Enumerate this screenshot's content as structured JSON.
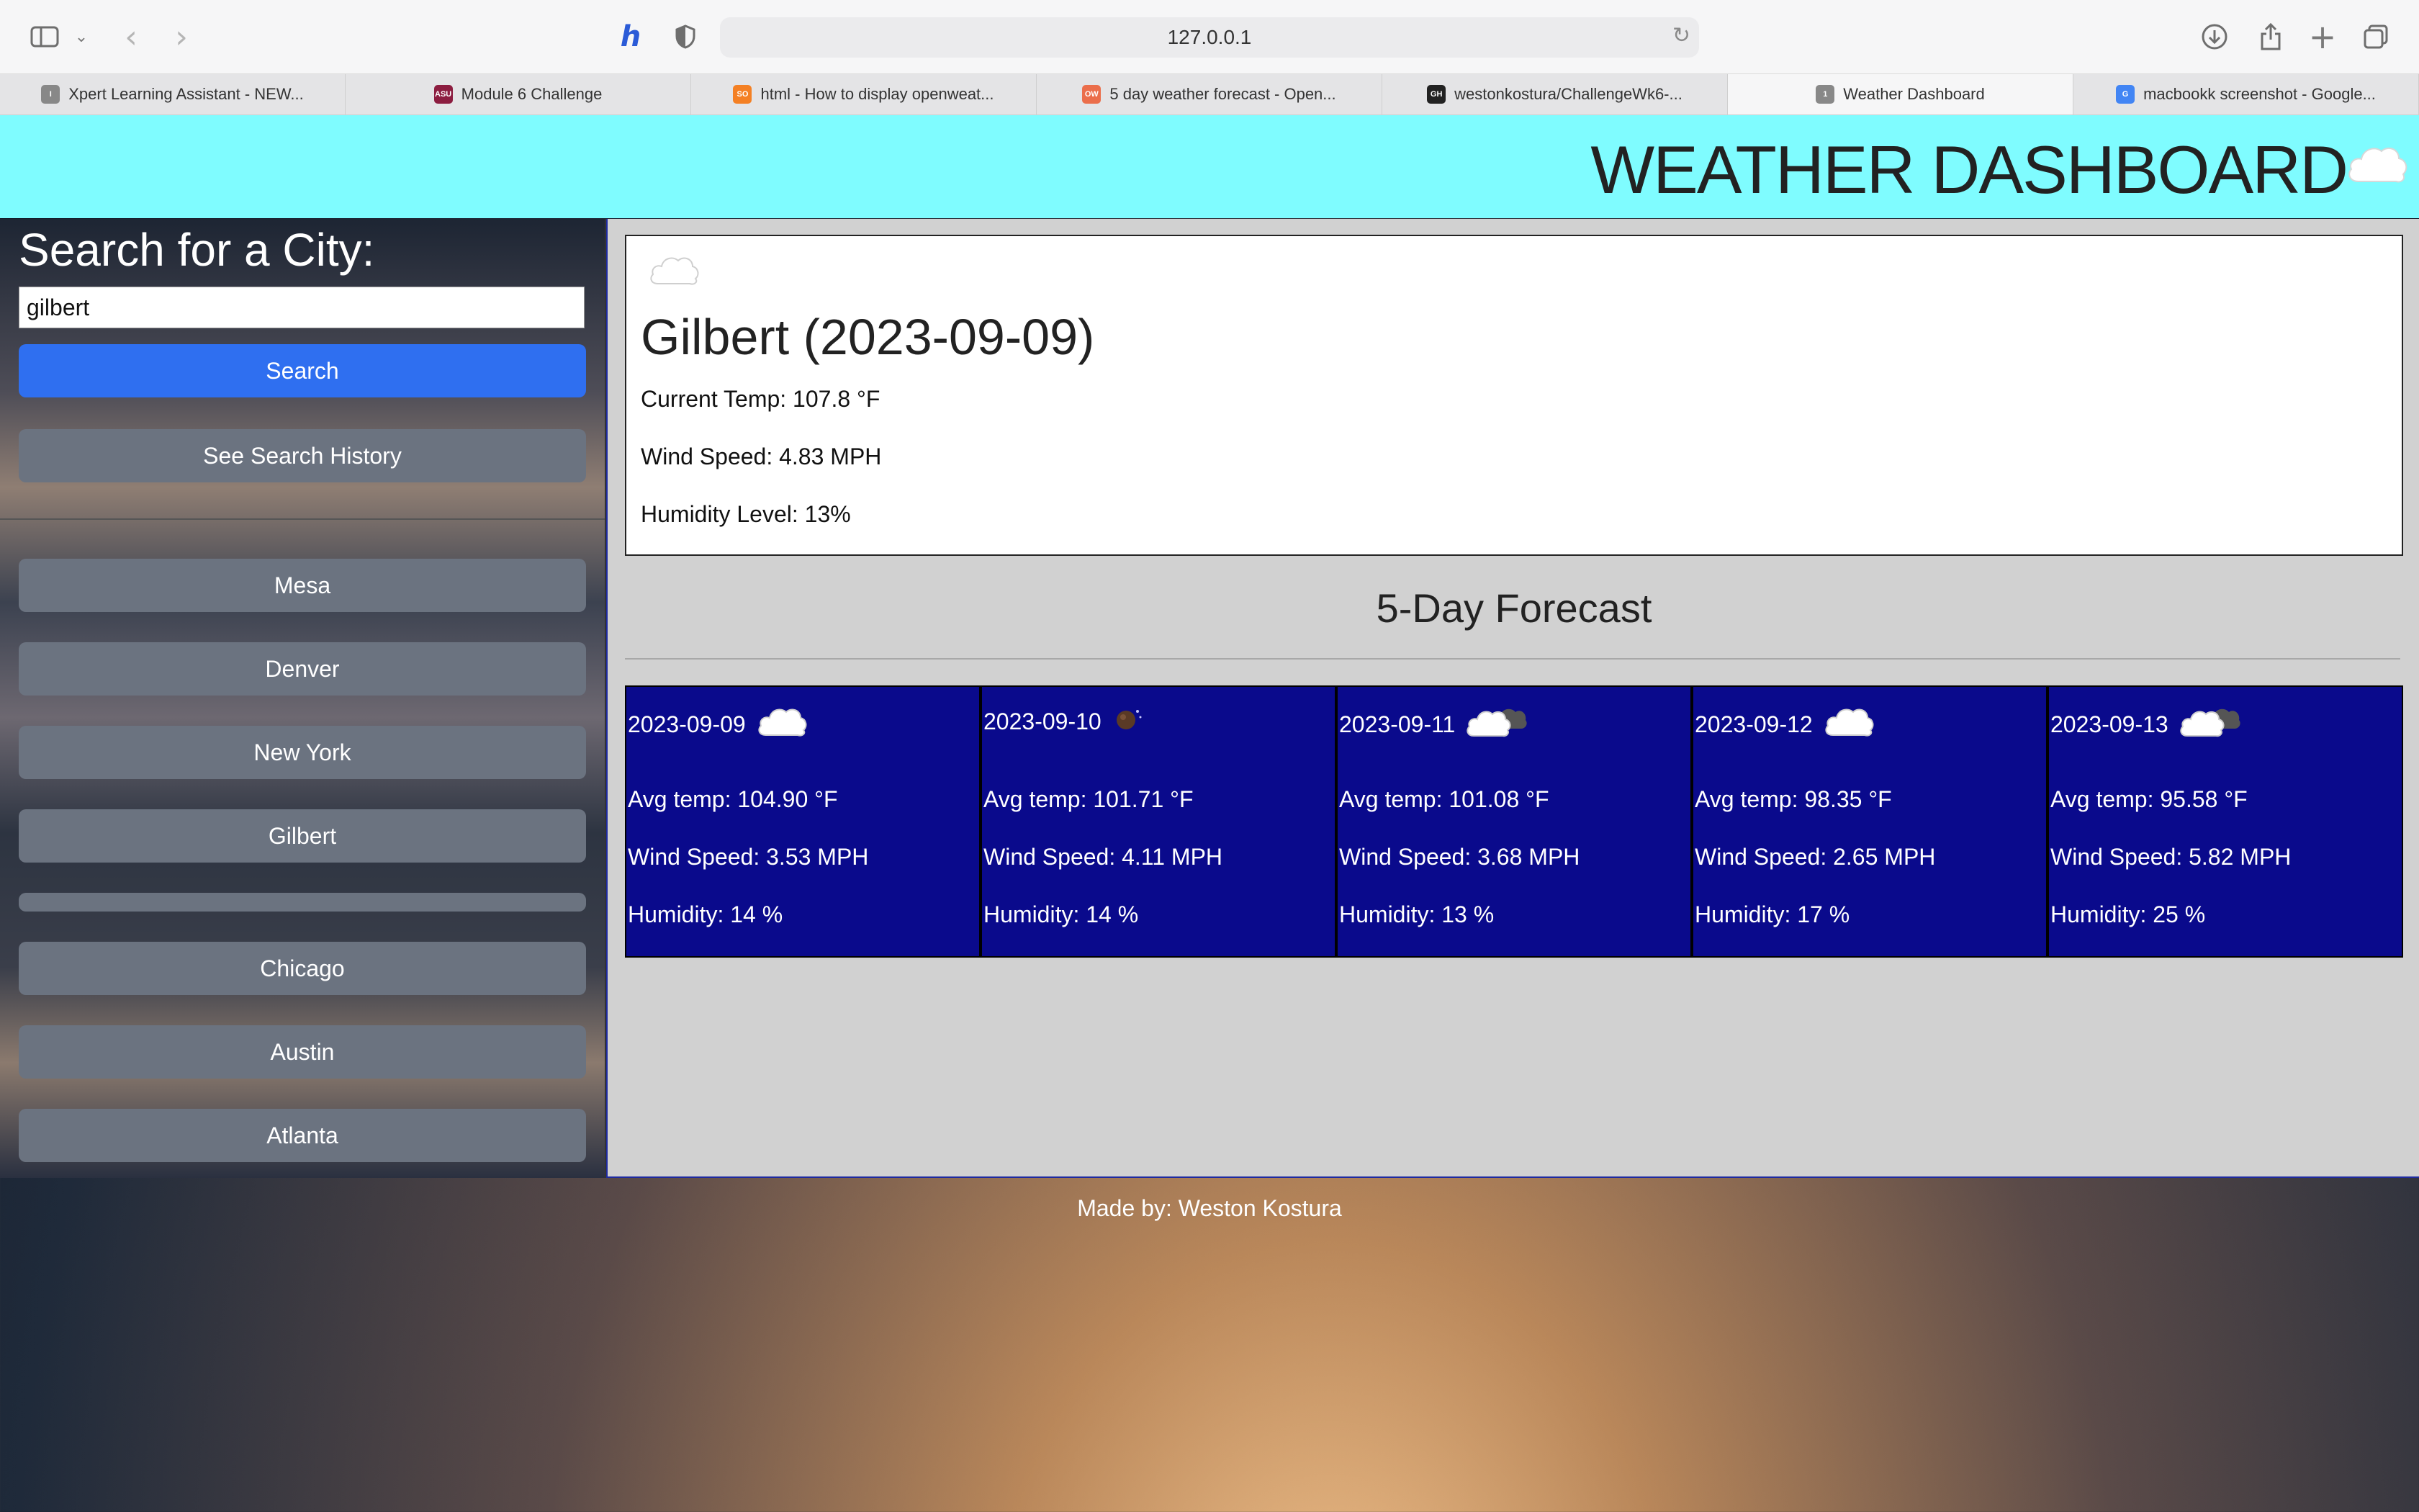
{
  "browser": {
    "url": "127.0.0.1",
    "tabs": [
      {
        "label": "Xpert Learning Assistant - NEW...",
        "favicon": "I",
        "color": "#888888"
      },
      {
        "label": "Module 6 Challenge",
        "favicon": "ASU",
        "color": "#8c1d40"
      },
      {
        "label": "html - How to display openweat...",
        "favicon": "SO",
        "color": "#f48024"
      },
      {
        "label": "5 day weather forecast - Open...",
        "favicon": "OW",
        "color": "#eb6e4b"
      },
      {
        "label": "westonkostura/ChallengeWk6-...",
        "favicon": "GH",
        "color": "#222222"
      },
      {
        "label": "Weather Dashboard",
        "favicon": "1",
        "color": "#888888",
        "active": true
      },
      {
        "label": "macbookk screenshot - Google...",
        "favicon": "G",
        "color": "#4285f4"
      }
    ]
  },
  "header": {
    "title": "WEATHER DASHBOARD"
  },
  "sidebar": {
    "heading": "Search for a City:",
    "search_value": "gilbert",
    "search_button": "Search",
    "history_button": "See Search History",
    "cities": [
      "Mesa",
      "Denver",
      "New York",
      "Gilbert",
      "",
      "Chicago",
      "Austin",
      "Atlanta"
    ]
  },
  "current": {
    "icon": "cloud-icon",
    "title": "Gilbert (2023-09-09)",
    "temp": "Current Temp: 107.8 °F",
    "wind": "Wind Speed: 4.83 MPH",
    "humidity": "Humidity Level: 13%"
  },
  "forecast": {
    "heading": "5-Day Forecast",
    "days": [
      {
        "date": "2023-09-09",
        "icon": "cloud-icon",
        "temp": "Avg temp: 104.90 °F",
        "wind": "Wind Speed: 3.53 MPH",
        "humidity": "Humidity: 14 %"
      },
      {
        "date": "2023-09-10",
        "icon": "clear-night-icon",
        "temp": "Avg temp: 101.71 °F",
        "wind": "Wind Speed: 4.11 MPH",
        "humidity": "Humidity: 14 %"
      },
      {
        "date": "2023-09-11",
        "icon": "dark-cloud-icon",
        "temp": "Avg temp: 101.08 °F",
        "wind": "Wind Speed: 3.68 MPH",
        "humidity": "Humidity: 13 %"
      },
      {
        "date": "2023-09-12",
        "icon": "cloud-icon",
        "temp": "Avg temp: 98.35 °F",
        "wind": "Wind Speed: 2.65 MPH",
        "humidity": "Humidity: 17 %"
      },
      {
        "date": "2023-09-13",
        "icon": "dark-cloud-icon",
        "temp": "Avg temp: 95.58 °F",
        "wind": "Wind Speed: 5.82 MPH",
        "humidity": "Humidity: 25 %"
      }
    ]
  },
  "footer": {
    "text": "Made by: Weston Kostura"
  }
}
